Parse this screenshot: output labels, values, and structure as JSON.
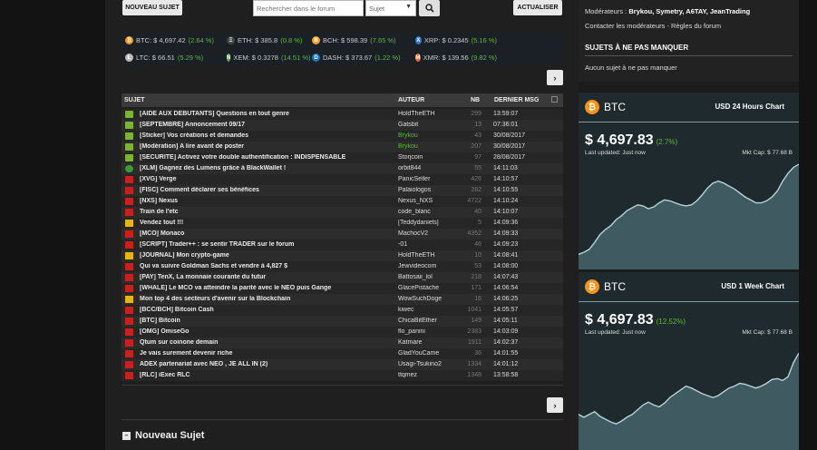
{
  "toolbar": {
    "new_topic": "NOUVEAU SUJET",
    "search_placeholder": "Rechercher dans le forum",
    "scope": "Sujet",
    "refresh": "ACTUALISER"
  },
  "tickers": [
    [
      {
        "sym": "BTC",
        "price": "$ 4,697.42",
        "pct": "(2.64 %)",
        "color": "#f7931a",
        "glyph": "₿"
      },
      {
        "sym": "ETH",
        "price": "$ 385.8",
        "pct": "(0.8 %)",
        "color": "#444",
        "glyph": "Ξ"
      },
      {
        "sym": "BCH",
        "price": "$ 598.39",
        "pct": "(7.65 %)",
        "color": "#f0a030",
        "glyph": "B"
      },
      {
        "sym": "XRP",
        "price": "$ 0.2345",
        "pct": "(5.16 %)",
        "color": "#2a78c8",
        "glyph": "X"
      }
    ],
    [
      {
        "sym": "LTC",
        "price": "$ 66.51",
        "pct": "(5.29 %)",
        "color": "#bbbbbb",
        "glyph": "Ł"
      },
      {
        "sym": "XEM",
        "price": "$ 0.3278",
        "pct": "(14.51 %)",
        "color": "#5fb34a",
        "glyph": "N"
      },
      {
        "sym": "DASH",
        "price": "$ 373.67",
        "pct": "(1.22 %)",
        "color": "#1c75bc",
        "glyph": "D"
      },
      {
        "sym": "XMR",
        "price": "$ 139.56",
        "pct": "(9.82 %)",
        "color": "#f26822",
        "glyph": "M"
      }
    ]
  ],
  "table": {
    "headers": {
      "subject": "SUJET",
      "author": "AUTEUR",
      "nb": "NB",
      "last": "DERNIER MSG"
    },
    "rows": [
      {
        "icon": "pin",
        "title": "[AIDE AUX DEBUTANTS] Questions en tout genre",
        "author": "HoldTheETH",
        "nb": "299",
        "date": "13:59:07",
        "author_color": "#ddd"
      },
      {
        "icon": "pin",
        "title": "[SEPTEMBRE] Annoncement 09/17",
        "author": "Gatsbit",
        "nb": "13",
        "date": "07:36:01",
        "author_color": "#ddd"
      },
      {
        "icon": "pin",
        "title": "[Sticker] Vos créations et demandes",
        "author": "Brykou",
        "nb": "43",
        "date": "30/08/2017",
        "author_color": "#5eb83b"
      },
      {
        "icon": "pin",
        "title": "[Modération] A lire avant de poster",
        "author": "Brykou",
        "nb": "207",
        "date": "30/08/2017",
        "author_color": "#5eb83b"
      },
      {
        "icon": "pin",
        "title": "[SECURITE] Activez votre double authentification : INDISPENSABLE",
        "author": "Storjcoin",
        "nb": "97",
        "date": "28/08/2017",
        "author_color": "#ddd"
      },
      {
        "icon": "green",
        "title": "[XLM] Gagnez des Lumens grâce à BlackWallet !",
        "author": "orbit844",
        "nb": "55",
        "date": "14:11:03",
        "author_color": "#ddd"
      },
      {
        "icon": "red",
        "title": "[XVG] Verge",
        "author": "PanicSeller",
        "nb": "426",
        "date": "14:10:57",
        "author_color": "#ddd"
      },
      {
        "icon": "red",
        "title": "[FISC] Comment déclarer ses bénéfices",
        "author": "Palaiologos",
        "nb": "282",
        "date": "14:10:55",
        "author_color": "#ddd"
      },
      {
        "icon": "red",
        "title": "[NXS] Nexus",
        "author": "Nexus_NXS",
        "nb": "4722",
        "date": "14:10:24",
        "author_color": "#ddd"
      },
      {
        "icon": "red",
        "title": "Train de l'etc",
        "author": "code_blanc",
        "nb": "40",
        "date": "14:10:07",
        "author_color": "#ddd"
      },
      {
        "icon": "yellow",
        "title": "Vendez tout !!!",
        "author": "[Teddydaniels]",
        "nb": "5",
        "date": "14:09:36",
        "author_color": "#ddd"
      },
      {
        "icon": "red",
        "title": "[MCO] Monaco",
        "author": "MachocV2",
        "nb": "4352",
        "date": "14:09:33",
        "author_color": "#ddd"
      },
      {
        "icon": "red",
        "title": "[SCRIPT] Trader++ : se sentir TRADER sur le forum",
        "author": "-01",
        "nb": "46",
        "date": "14:09:23",
        "author_color": "#ddd"
      },
      {
        "icon": "yellow",
        "title": "[JOURNAL] Mon crypto-game",
        "author": "HoldTheETH",
        "nb": "10",
        "date": "14:08:41",
        "author_color": "#ddd"
      },
      {
        "icon": "red",
        "title": "Qui va suivre Goldman Sachs et vendre à 4,827 $",
        "author": "Jewvideocom",
        "nb": "53",
        "date": "14:08:00",
        "author_color": "#ddd"
      },
      {
        "icon": "red",
        "title": "[PAY] TenX, La monnaie courante du futur",
        "author": "Battosaii_lol",
        "nb": "218",
        "date": "14:07:43",
        "author_color": "#ddd"
      },
      {
        "icon": "red",
        "title": "[WHALE] Le MCO va atteindre la parité avec le NEO puis Gange",
        "author": "GlacePistache",
        "nb": "171",
        "date": "14:06:54",
        "author_color": "#ddd"
      },
      {
        "icon": "yellow",
        "title": "Mon top 4 des secteurs d'avenir sur la Blockchain",
        "author": "WowSuchDoge",
        "nb": "16",
        "date": "14:06:25",
        "author_color": "#ddd"
      },
      {
        "icon": "red",
        "title": "[BCC/BCH] Bitcoin Cash",
        "author": "kiwec",
        "nb": "1041",
        "date": "14:05:57",
        "author_color": "#ddd"
      },
      {
        "icon": "red",
        "title": "[BTC] Bitcoin",
        "author": "ChicaBitEther",
        "nb": "149",
        "date": "14:05:11",
        "author_color": "#ddd"
      },
      {
        "icon": "red",
        "title": "[OMG] OmiseGo",
        "author": "flo_panini",
        "nb": "2383",
        "date": "14:03:09",
        "author_color": "#ddd"
      },
      {
        "icon": "red",
        "title": "Qtum sur coinone demain",
        "author": "Katmare",
        "nb": "1911",
        "date": "14:02:37",
        "author_color": "#ddd"
      },
      {
        "icon": "red",
        "title": "Je vais surement devenir riche",
        "author": "GladYouCame",
        "nb": "36",
        "date": "14:01:55",
        "author_color": "#ddd"
      },
      {
        "icon": "red",
        "title": "ADEX partenariat avec NEO , JE ALL IN (2)",
        "author": "Usagi-Tsukino2",
        "nb": "1334",
        "date": "14:01:12",
        "author_color": "#ddd"
      },
      {
        "icon": "red",
        "title": "[RLC] iExec RLC",
        "author": "ttqmez",
        "nb": "1348",
        "date": "13:58:58",
        "author_color": "#ddd"
      }
    ]
  },
  "next_glyph": "›",
  "new_topic_section": {
    "label": "Nouveau Sujet",
    "toggle": "–"
  },
  "sidebar": {
    "mods_label": "Modérateurs : ",
    "mods": "Brykou, Symetry, A6TAY, JeanTrading",
    "contact": "Contacter les modérateurs - Règles du forum",
    "must_heading": "SUJETS À NE PAS MANQUER",
    "must_empty": "Aucun sujet à ne pas manquer"
  },
  "charts": [
    {
      "coin": "BTC",
      "title": "USD 24 Hours Chart",
      "price": "$ 4,697.83",
      "change": "(2.7%)",
      "updated": "Last updated: Just now",
      "mktcap": "Mkt Cap: $ 77.68 B",
      "series": [
        0.08,
        0.1,
        0.13,
        0.2,
        0.28,
        0.33,
        0.37,
        0.43,
        0.47,
        0.52,
        0.55,
        0.58,
        0.57,
        0.54,
        0.56,
        0.6,
        0.63,
        0.62,
        0.6,
        0.58,
        0.57,
        0.58,
        0.62,
        0.68,
        0.75,
        0.8,
        0.82,
        0.8,
        0.77,
        0.74,
        0.7,
        0.66,
        0.63,
        0.6,
        0.6,
        0.62,
        0.66,
        0.72,
        0.82,
        0.9,
        0.96,
        0.99
      ]
    },
    {
      "coin": "BTC",
      "title": "USD 1 Week Chart",
      "price": "$ 4,697.83",
      "change": "(12.52%)",
      "updated": "Last updated: Just now",
      "mktcap": "Mkt Cap: $ 77.68 B",
      "series": [
        0.3,
        0.27,
        0.3,
        0.33,
        0.28,
        0.25,
        0.22,
        0.2,
        0.23,
        0.27,
        0.3,
        0.35,
        0.4,
        0.43,
        0.4,
        0.38,
        0.42,
        0.48,
        0.52,
        0.56,
        0.6,
        0.58,
        0.55,
        0.52,
        0.5,
        0.48,
        0.5,
        0.54,
        0.58,
        0.6,
        0.63,
        0.62,
        0.6,
        0.58,
        0.6,
        0.63,
        0.67,
        0.68,
        0.66,
        0.7,
        0.85,
        0.95
      ]
    }
  ]
}
